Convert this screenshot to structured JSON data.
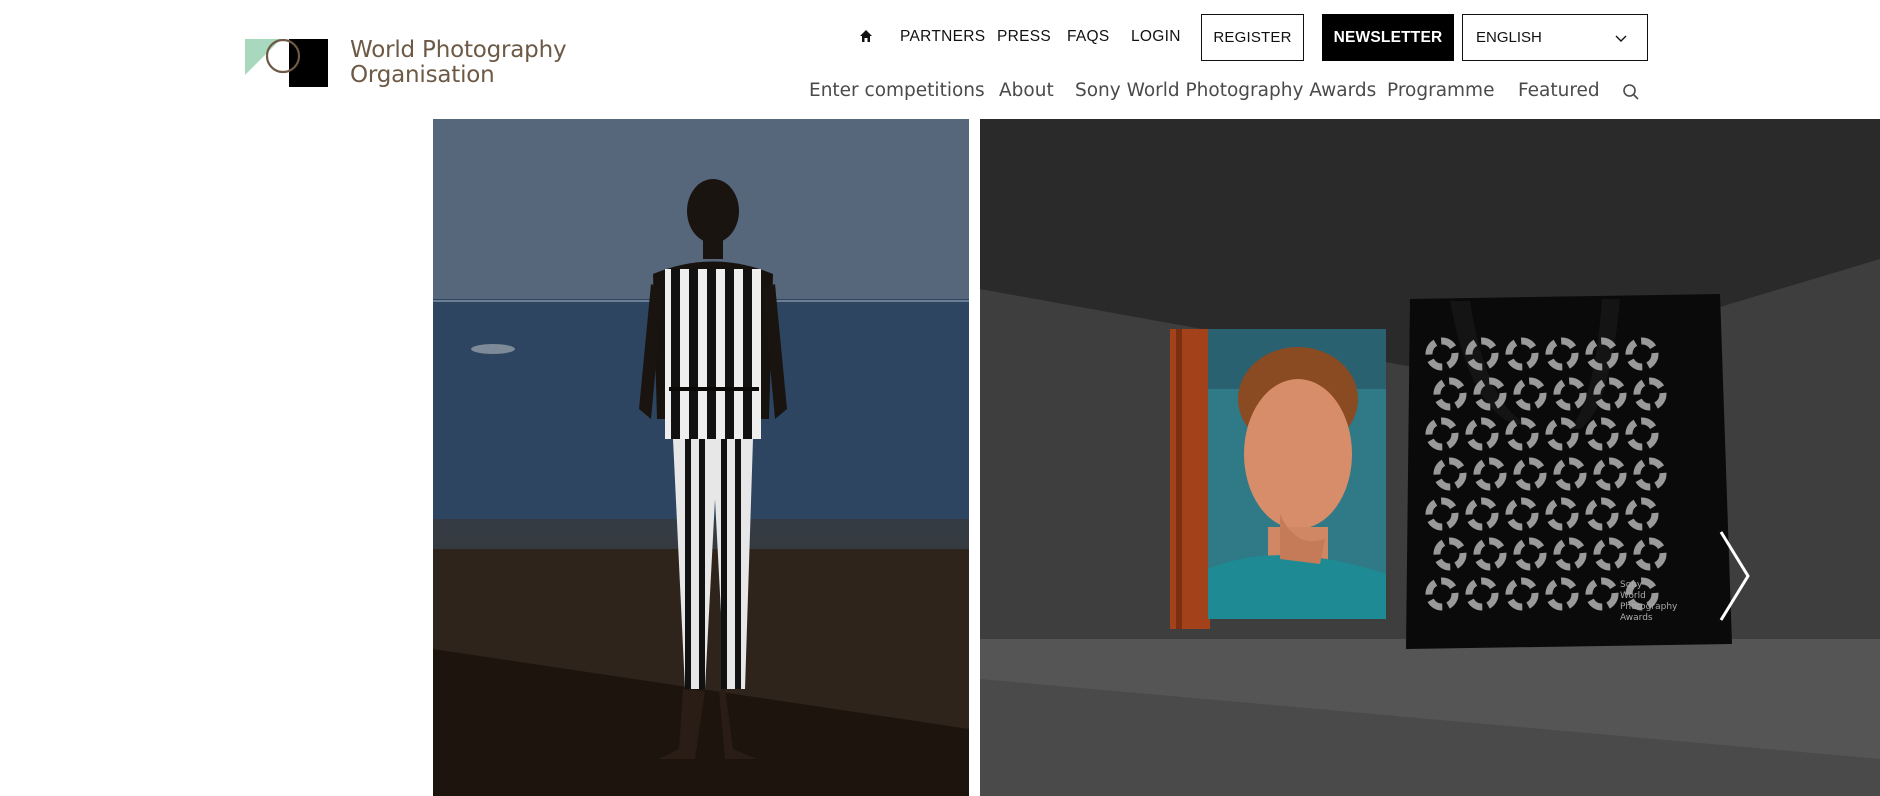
{
  "brand": {
    "name_line1": "World Photography",
    "name_line2": "Organisation",
    "colors": {
      "mint": "#a8d8bd",
      "brown": "#6d5a46",
      "black": "#000000"
    }
  },
  "topnav": {
    "home_icon": "home-icon",
    "links": [
      "PARTNERS",
      "PRESS",
      "FAQS",
      "LOGIN"
    ],
    "register_label": "REGISTER",
    "newsletter_label": "NEWSLETTER",
    "language": "ENGLISH"
  },
  "mainnav": {
    "links": [
      "Enter competitions",
      "About",
      "Sony World Photography Awards",
      "Programme",
      "Featured"
    ],
    "search_icon": "search-icon"
  },
  "slider": {
    "next_icon": "chevron-right-icon",
    "slides": [
      {
        "name": "man-in-striped-swimsuit-photo"
      },
      {
        "name": "book-and-tote-bag-photo"
      }
    ],
    "tote_text": [
      "Sony",
      "World",
      "Photography",
      "Awards"
    ]
  }
}
